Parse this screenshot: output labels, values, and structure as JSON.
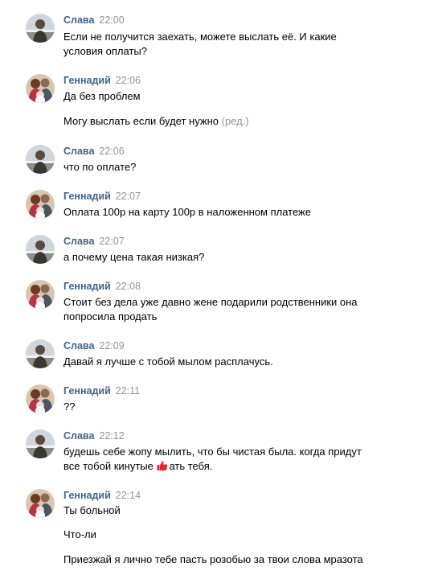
{
  "messages": [
    {
      "author": "Слава",
      "time": "22:00",
      "avatar": "slava-avatar-icon",
      "lines": [
        "Если не получится заехать, можете выслать её. И какие",
        "условия оплаты?"
      ]
    },
    {
      "author": "Геннадий",
      "time": "22:06",
      "avatar": "gennadiy-avatar-icon",
      "lines": [
        "Да без проблем"
      ]
    },
    {
      "author": "",
      "time": "",
      "avatar": "",
      "lines": [
        "Могу выслать если будет нужно"
      ],
      "edited": "(ред.)"
    },
    {
      "author": "Слава",
      "time": "22:06",
      "avatar": "slava-avatar-icon",
      "lines": [
        "что по оплате?"
      ]
    },
    {
      "author": "Геннадий",
      "time": "22:07",
      "avatar": "gennadiy-avatar-icon",
      "lines": [
        "Оплата 100р на карту 100р в наложенном платеже"
      ]
    },
    {
      "author": "Слава",
      "time": "22:07",
      "avatar": "slava-avatar-icon",
      "lines": [
        "а почему цена такая низкая?"
      ]
    },
    {
      "author": "Геннадий",
      "time": "22:08",
      "avatar": "gennadiy-avatar-icon",
      "lines": [
        "Стоит без дела уже давно жене подарили родственники она",
        "попросила продать"
      ]
    },
    {
      "author": "Слава",
      "time": "22:09",
      "avatar": "slava-avatar-icon",
      "lines": [
        "Давай я лучше с тобой мылом расплачусь."
      ]
    },
    {
      "author": "Геннадий",
      "time": "22:11",
      "avatar": "gennadiy-avatar-icon",
      "lines": [
        "??"
      ]
    },
    {
      "author": "Слава",
      "time": "22:12",
      "avatar": "slava-avatar-icon",
      "lines": [
        "будешь себе жопу мылить, что бы чистая была. когда придут"
      ],
      "line2_before": "все тобой кинутые ",
      "line2_after": "ать тебя.",
      "emoji": "thumbs-up-emoji-icon"
    },
    {
      "author": "Геннадий",
      "time": "22:14",
      "avatar": "gennadiy-avatar-icon",
      "lines": [
        "Ты больной"
      ]
    },
    {
      "author": "",
      "time": "",
      "avatar": "",
      "lines": [
        "Что-ли"
      ]
    },
    {
      "author": "",
      "time": "",
      "avatar": "",
      "lines": [
        "Приезжай я лично тебе пасть розобью за твои слова мразота"
      ]
    }
  ],
  "colors": {
    "author": "#42648b",
    "time": "#939393",
    "emoji": "#e3262f"
  }
}
